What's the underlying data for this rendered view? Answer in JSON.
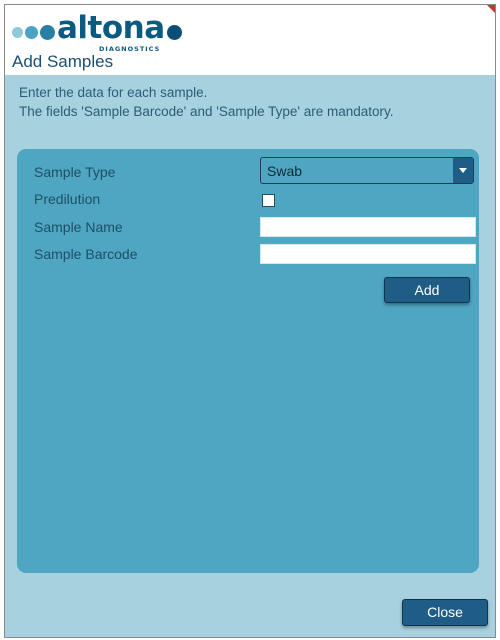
{
  "header": {
    "logo_wordmark": "altona",
    "logo_subtitle": "DIAGNOSTICS",
    "dialog_title": "Add Samples"
  },
  "instructions": {
    "line1": "Enter the data for each sample.",
    "line2": "The fields 'Sample Barcode' and 'Sample Type' are mandatory."
  },
  "form": {
    "sample_type_label": "Sample Type",
    "sample_type_value": "Swab",
    "predilution_label": "Predilution",
    "predilution_checked": false,
    "sample_name_label": "Sample Name",
    "sample_name_value": "",
    "sample_barcode_label": "Sample Barcode",
    "sample_barcode_value": "",
    "add_button_label": "Add"
  },
  "footer": {
    "close_button_label": "Close"
  },
  "colors": {
    "dialog_background": "#a7d1df",
    "panel_background": "#4ea6c2",
    "button_background": "#1f5d86",
    "brand_dark": "#0b5a82"
  }
}
